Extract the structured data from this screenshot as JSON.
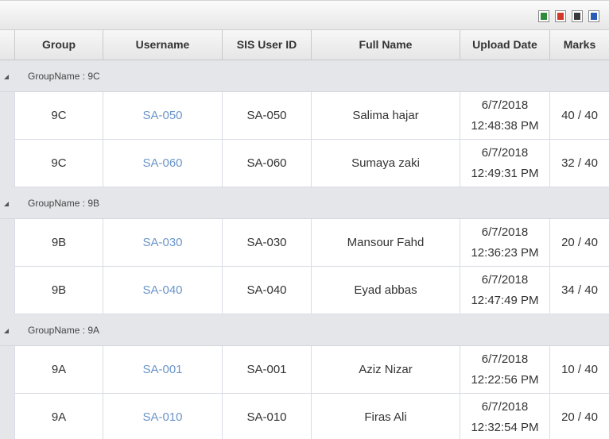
{
  "toolbar": {
    "export_buttons": [
      {
        "icon": "excel-icon",
        "color": "#2e8b3a"
      },
      {
        "icon": "pdf-icon",
        "color": "#d03a2a"
      },
      {
        "icon": "csv-icon",
        "color": "#3a3a3a"
      },
      {
        "icon": "word-icon",
        "color": "#2a5bb5"
      }
    ]
  },
  "columns": [
    "Group",
    "Username",
    "SIS User ID",
    "Full Name",
    "Upload Date",
    "Marks"
  ],
  "groups": [
    {
      "label": "GroupName : 9C",
      "rows": [
        {
          "group": "9C",
          "username": "SA-050",
          "sis_id": "SA-050",
          "full_name": "Salima hajar",
          "date": "6/7/2018",
          "time": "12:48:38 PM",
          "marks": "40 / 40"
        },
        {
          "group": "9C",
          "username": "SA-060",
          "sis_id": "SA-060",
          "full_name": "Sumaya zaki",
          "date": "6/7/2018",
          "time": "12:49:31 PM",
          "marks": "32 / 40"
        }
      ]
    },
    {
      "label": "GroupName : 9B",
      "rows": [
        {
          "group": "9B",
          "username": "SA-030",
          "sis_id": "SA-030",
          "full_name": "Mansour Fahd",
          "date": "6/7/2018",
          "time": "12:36:23 PM",
          "marks": "20 / 40"
        },
        {
          "group": "9B",
          "username": "SA-040",
          "sis_id": "SA-040",
          "full_name": "Eyad abbas",
          "date": "6/7/2018",
          "time": "12:47:49 PM",
          "marks": "34 / 40"
        }
      ]
    },
    {
      "label": "GroupName : 9A",
      "rows": [
        {
          "group": "9A",
          "username": "SA-001",
          "sis_id": "SA-001",
          "full_name": "Aziz Nizar",
          "date": "6/7/2018",
          "time": "12:22:56 PM",
          "marks": "10 / 40"
        },
        {
          "group": "9A",
          "username": "SA-010",
          "sis_id": "SA-010",
          "full_name": "Firas Ali",
          "date": "6/7/2018",
          "time": "12:32:54 PM",
          "marks": "20 / 40"
        }
      ]
    }
  ]
}
